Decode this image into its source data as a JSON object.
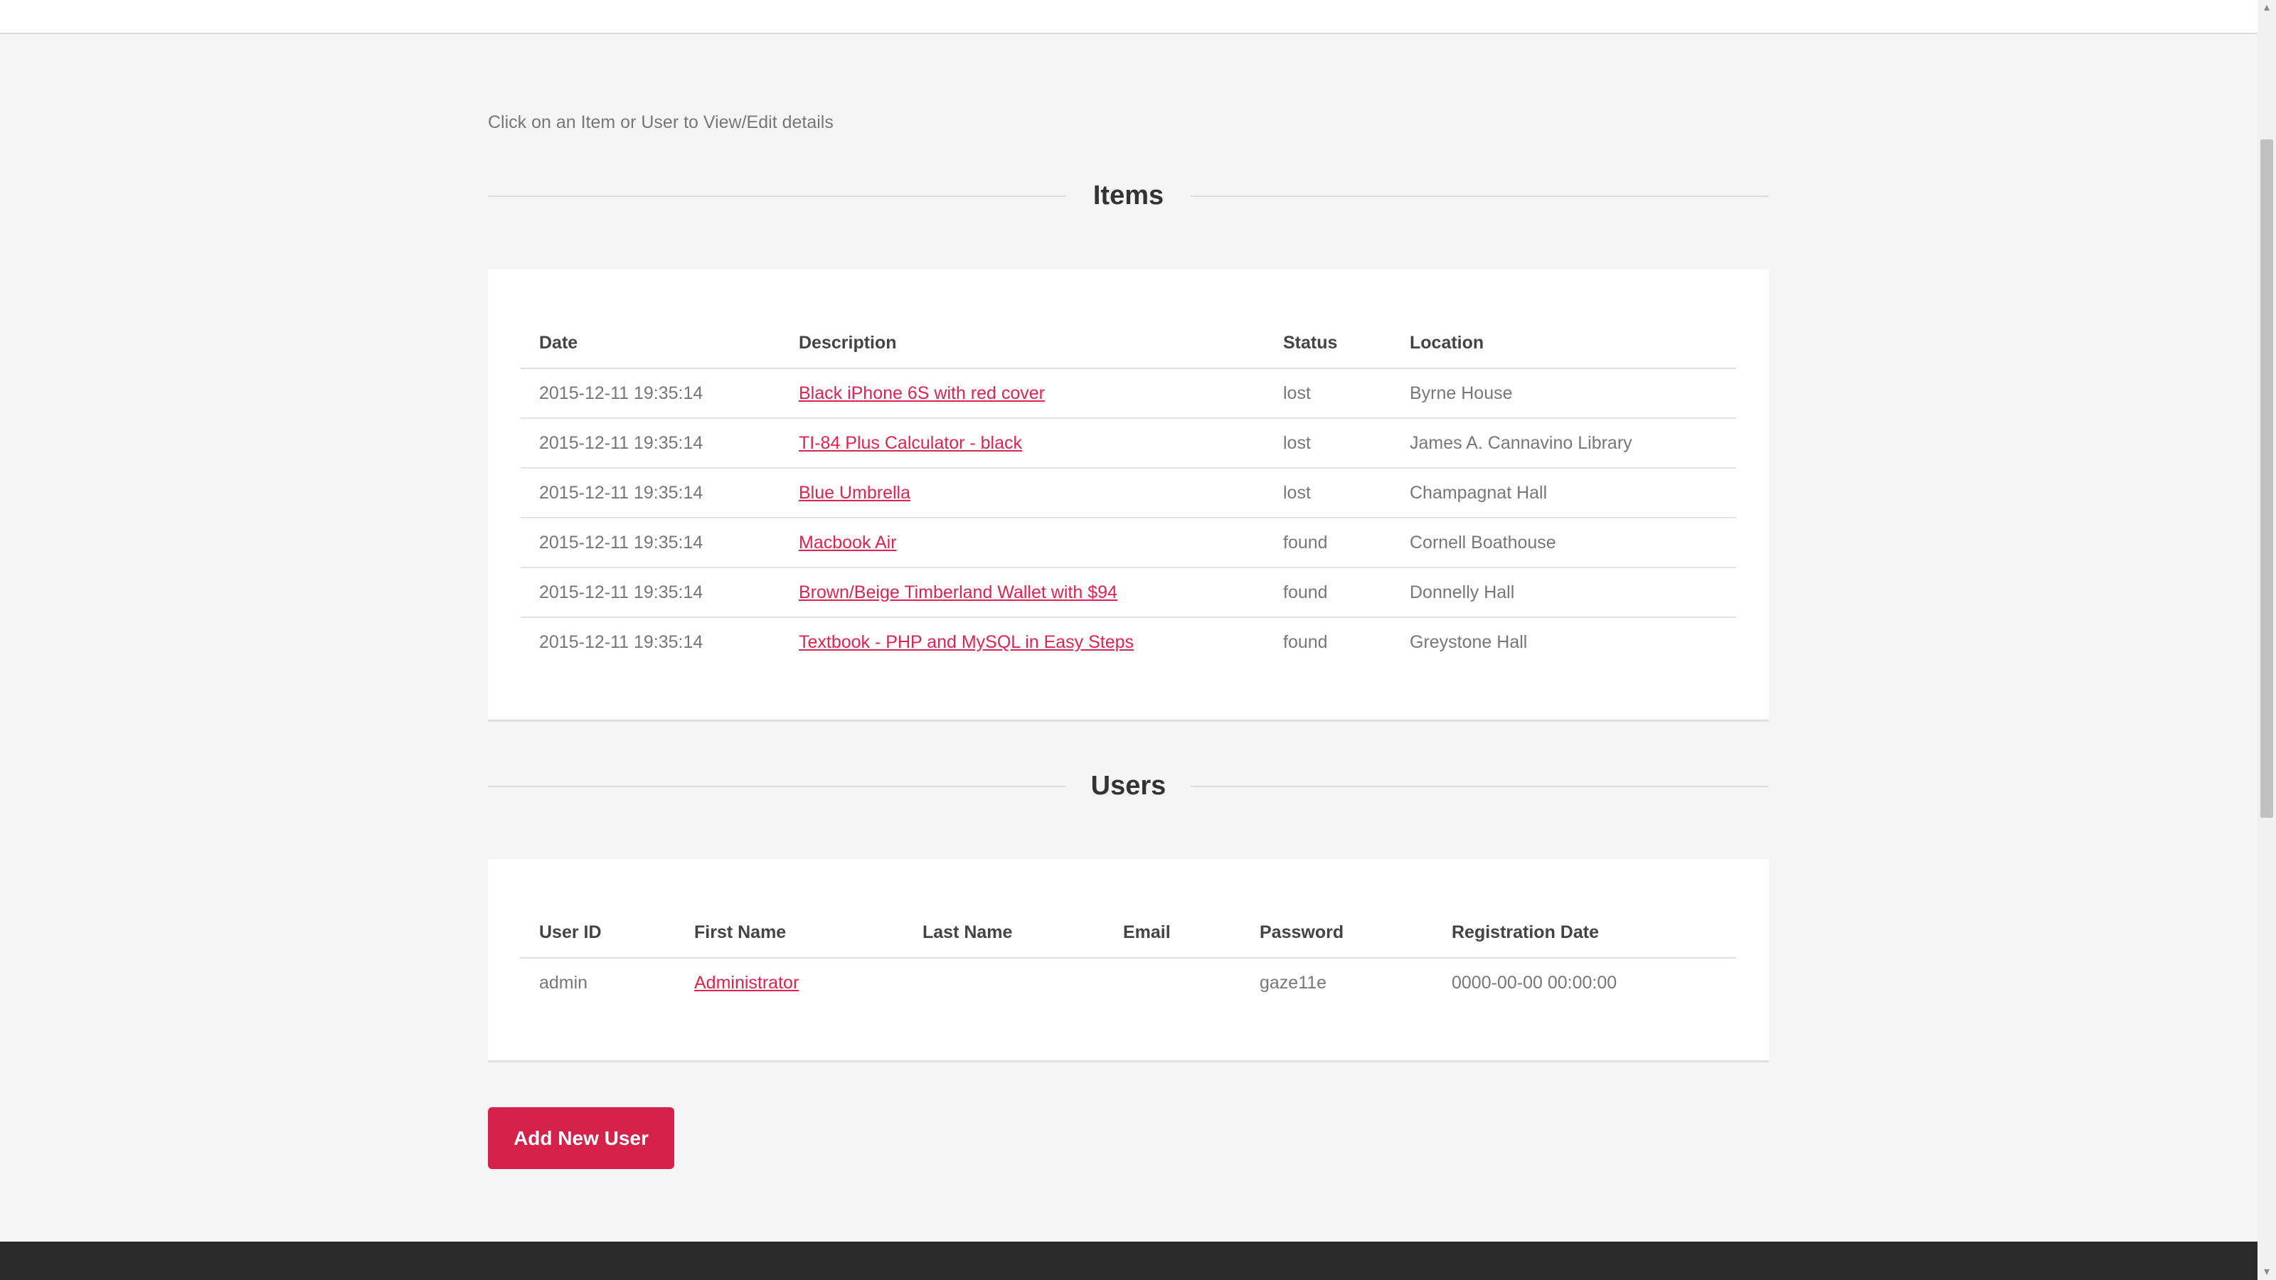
{
  "instructions": "Click on an Item or User to View/Edit details",
  "items_section": {
    "title": "Items",
    "headers": [
      "Date",
      "Description",
      "Status",
      "Location"
    ],
    "rows": [
      {
        "date": "2015-12-11 19:35:14",
        "description": "Black iPhone 6S with red cover",
        "status": "lost",
        "location": "Byrne House"
      },
      {
        "date": "2015-12-11 19:35:14",
        "description": "TI-84 Plus Calculator - black",
        "status": "lost",
        "location": "James A. Cannavino Library"
      },
      {
        "date": "2015-12-11 19:35:14",
        "description": "Blue Umbrella",
        "status": "lost",
        "location": "Champagnat Hall"
      },
      {
        "date": "2015-12-11 19:35:14",
        "description": "Macbook Air",
        "status": "found",
        "location": "Cornell Boathouse"
      },
      {
        "date": "2015-12-11 19:35:14",
        "description": "Brown/Beige Timberland Wallet with $94",
        "status": "found",
        "location": "Donnelly Hall"
      },
      {
        "date": "2015-12-11 19:35:14",
        "description": "Textbook - PHP and MySQL in Easy Steps",
        "status": "found",
        "location": "Greystone Hall"
      }
    ]
  },
  "users_section": {
    "title": "Users",
    "headers": [
      "User ID",
      "First Name",
      "Last Name",
      "Email",
      "Password",
      "Registration Date"
    ],
    "rows": [
      {
        "user_id": "admin",
        "first_name": "Administrator",
        "last_name": "",
        "email": "",
        "password": "gaze11e",
        "registration_date": "0000-00-00 00:00:00"
      }
    ]
  },
  "add_user_button": "Add New User",
  "colors": {
    "accent": "#d6224a",
    "link": "#e0244f",
    "footer": "#2b2a2a"
  },
  "icons": {
    "scroll_up": "triangle-up-icon",
    "scroll_down": "triangle-down-icon"
  }
}
